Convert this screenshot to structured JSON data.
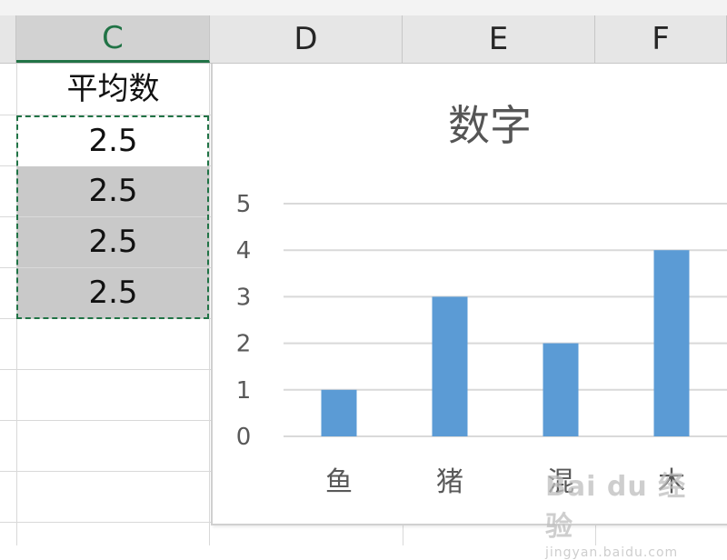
{
  "columns": [
    "C",
    "D",
    "E",
    "F"
  ],
  "cells": {
    "header": "平均数",
    "values": [
      "2.5",
      "2.5",
      "2.5",
      "2.5"
    ]
  },
  "chart_data": {
    "type": "bar",
    "title": "数字",
    "categories": [
      "鱼",
      "猪",
      "混",
      "木"
    ],
    "values": [
      1,
      3,
      2,
      4
    ],
    "ylim": [
      0,
      5
    ],
    "yticks": [
      "0",
      "1",
      "2",
      "3",
      "4",
      "5"
    ],
    "grid": true,
    "bar_color": "#5b9bd5"
  },
  "colors": {
    "selection": "#217346",
    "bar": "#5b9bd5"
  },
  "watermark": {
    "brand": "Bai du 经验",
    "url": "jingyan.baidu.com"
  }
}
